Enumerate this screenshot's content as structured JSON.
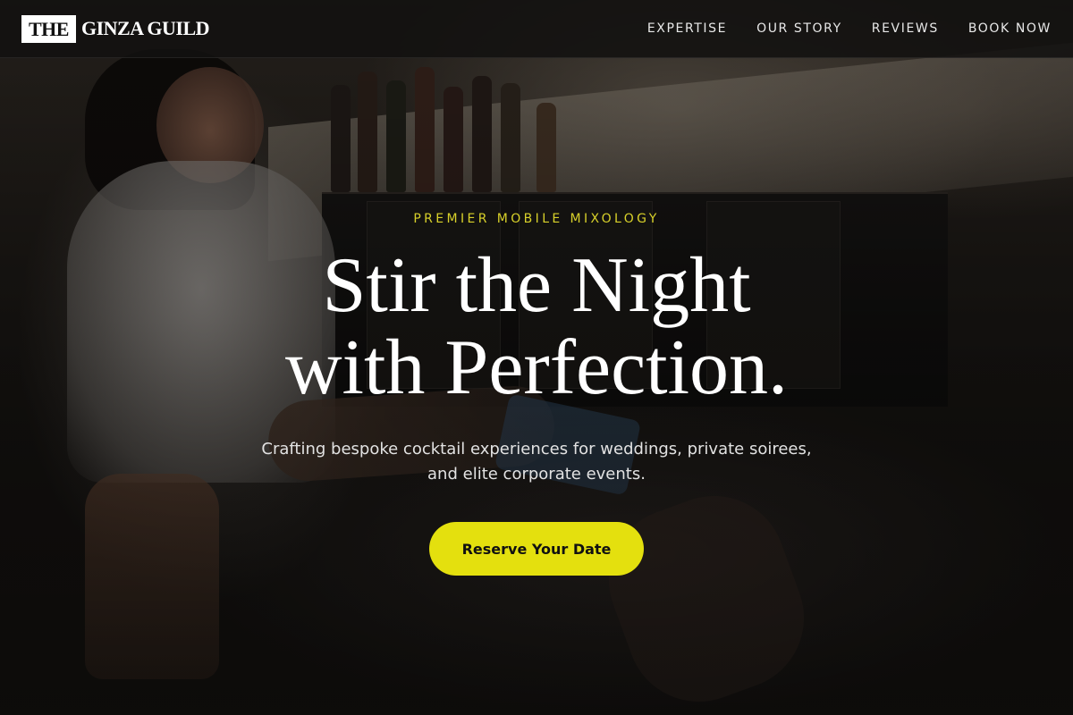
{
  "header": {
    "logo_box": "THE",
    "logo_text": "GINZA GUILD",
    "nav": [
      {
        "label": "EXPERTISE"
      },
      {
        "label": "OUR STORY"
      },
      {
        "label": "REVIEWS"
      },
      {
        "label": "BOOK NOW"
      }
    ]
  },
  "hero": {
    "eyebrow": "PREMIER MOBILE MIXOLOGY",
    "headline_line1": "Stir the Night",
    "headline_line2": "with Perfection.",
    "subtitle_line1": "Crafting bespoke cocktail experiences for weddings, private soirees,",
    "subtitle_line2": "and elite corporate events.",
    "cta_label": "Reserve Your Date"
  },
  "colors": {
    "accent": "#e4e00e",
    "eyebrow": "#d8d12a",
    "header_bg": "#121110"
  }
}
